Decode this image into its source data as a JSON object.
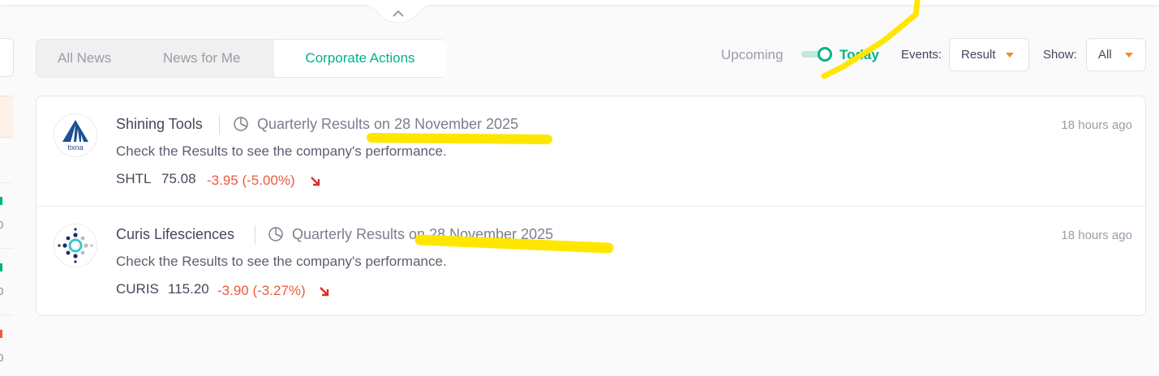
{
  "tabs": [
    {
      "label": "All News"
    },
    {
      "label": "News for Me"
    },
    {
      "label": "Corporate Actions",
      "active": true
    }
  ],
  "toggle": {
    "left_label": "Upcoming",
    "right_label": "Today",
    "state": "Today"
  },
  "filters": {
    "events": {
      "label": "Events:",
      "value": "Result"
    },
    "show": {
      "label": "Show:",
      "value": "All"
    }
  },
  "colors": {
    "accent": "#00b386",
    "negative": "#eb5b3c",
    "caret": "#f28c28",
    "highlight": "#ffe600"
  },
  "items": [
    {
      "company": "Shining Tools",
      "event": "Quarterly Results on 28 November 2025",
      "description": "Check the Results to see the company's performance.",
      "ticker": "SHTL",
      "price": "75.08",
      "change": "-3.95 (-5.00%)",
      "time": "18 hours ago",
      "logo_text": "tixna"
    },
    {
      "company": "Curis Lifesciences",
      "event": "Quarterly Results on 28 November 2025",
      "description": "Check the Results to see the company's performance.",
      "ticker": "CURIS",
      "price": "115.20",
      "change": "-3.90 (-3.27%)",
      "time": "18 hours ago"
    }
  ]
}
